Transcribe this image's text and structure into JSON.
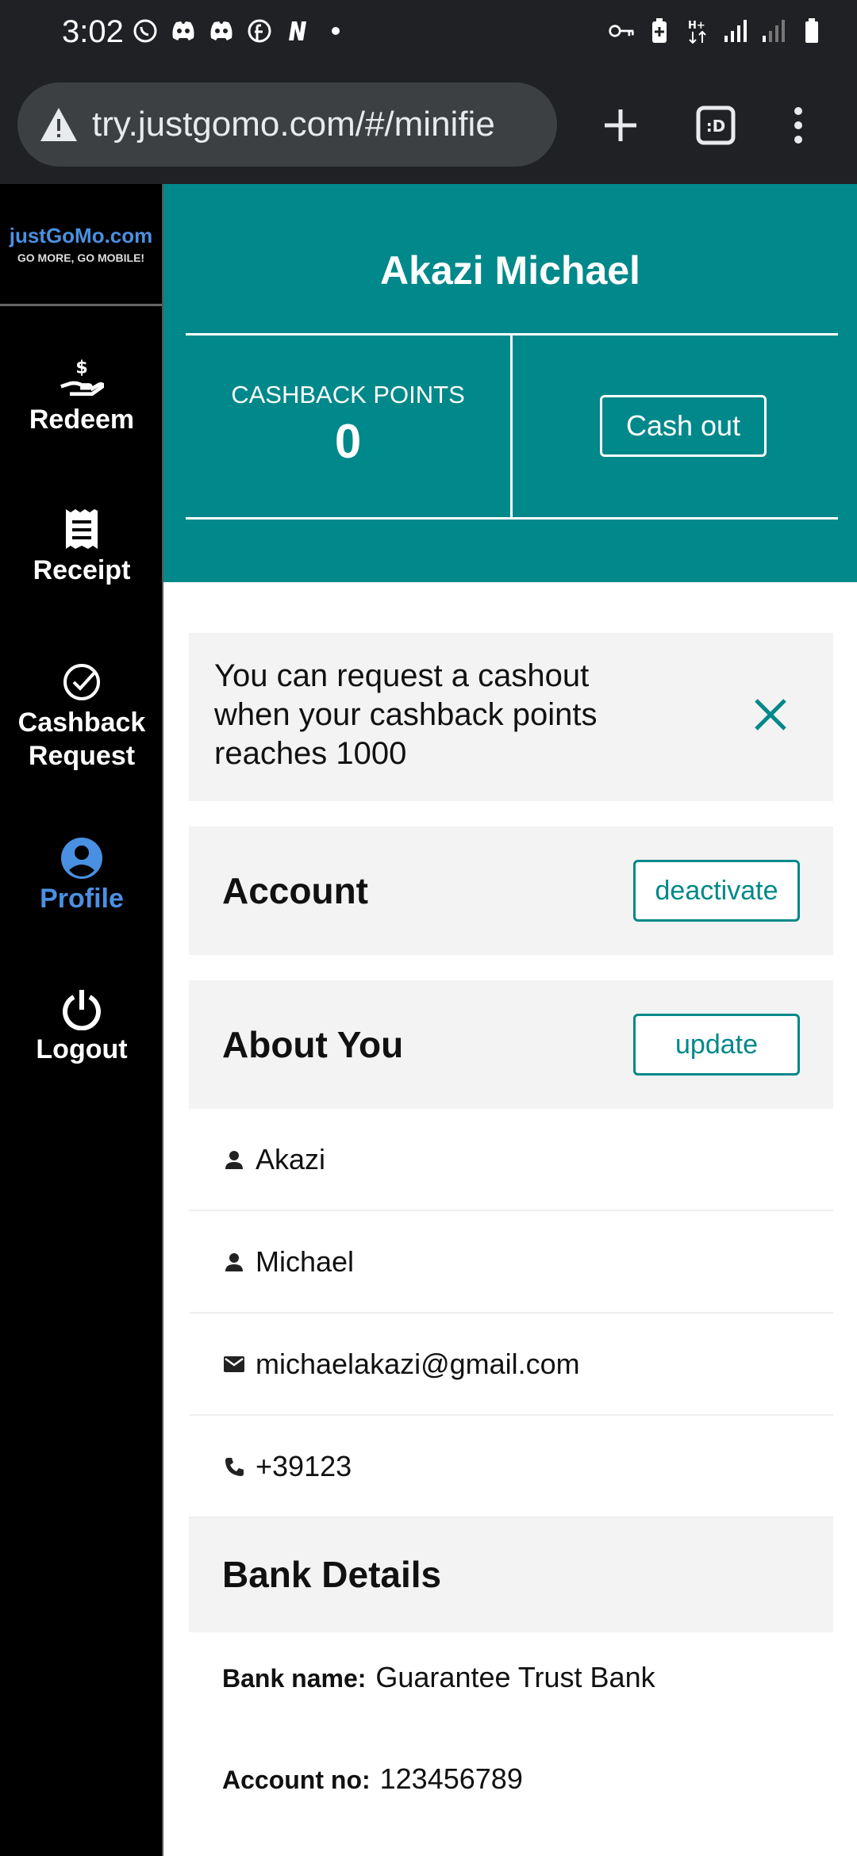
{
  "status_bar": {
    "time": "3:02",
    "left_icons": [
      "whatsapp-icon",
      "discord-icon",
      "discord-icon",
      "facebook-icon",
      "notion-icon",
      "dot-icon"
    ],
    "right_icons": [
      "vpn-key-icon",
      "battery-saver-icon",
      "data-arrows-icon",
      "signal-icon",
      "signal-weak-icon",
      "battery-icon"
    ]
  },
  "browser": {
    "url": "try.justgomo.com/#/minifie",
    "tab_count": ":D"
  },
  "sidebar": {
    "logo_main": "justGoMo.com",
    "logo_tagline": "GO MORE, GO MOBILE!",
    "items": [
      {
        "label": "Redeem",
        "icon": "hand-dollar-icon"
      },
      {
        "label": "Receipt",
        "icon": "receipt-icon"
      },
      {
        "label": "Cashback Request",
        "icon": "check-circle-icon"
      },
      {
        "label": "Profile",
        "icon": "account-circle-icon",
        "active": true
      },
      {
        "label": "Logout",
        "icon": "power-icon"
      }
    ]
  },
  "hero": {
    "name": "Akazi Michael",
    "points_label": "CASHBACK POINTS",
    "points_value": "0",
    "cashout_label": "Cash out"
  },
  "notice": {
    "text": "You can request a cashout when your cashback points reaches 1000"
  },
  "account_section": {
    "title": "Account",
    "button_label": "deactivate"
  },
  "about_section": {
    "title": "About You",
    "button_label": "update",
    "rows": [
      {
        "icon": "person-icon",
        "text": "Akazi"
      },
      {
        "icon": "person-icon",
        "text": "Michael"
      },
      {
        "icon": "mail-icon",
        "text": "michaelakazi@gmail.com"
      },
      {
        "icon": "phone-icon",
        "text": "+39123"
      }
    ]
  },
  "bank_section": {
    "title": "Bank Details",
    "bank_name_label": "Bank name:",
    "bank_name_value": "Guarantee Trust Bank",
    "account_no_label": "Account no:",
    "account_no_value": "123456789"
  },
  "colors": {
    "accent": "#00888a",
    "active_nav": "#4a90e2",
    "panel": "#f3f3f3"
  }
}
